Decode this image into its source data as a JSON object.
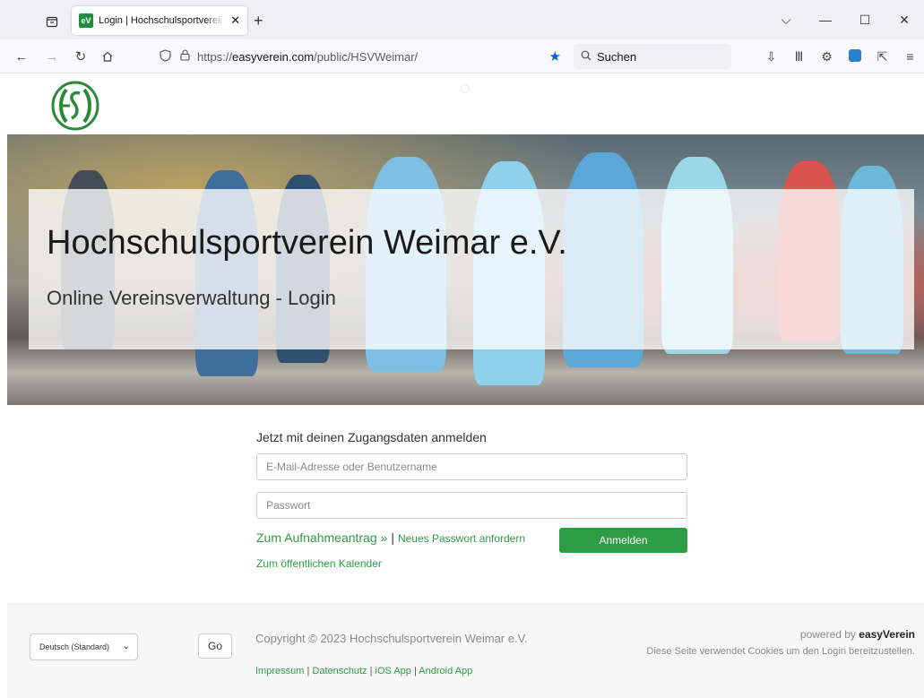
{
  "browser": {
    "tab_title": "Login | Hochschulsportverein Weimar e.V.",
    "tab_favicon": "eV",
    "url_prefix": "https://",
    "url_domain": "easyverein.com",
    "url_path": "/public/HSVWeimar/",
    "search_placeholder": "Suchen",
    "accent": "#0061e0"
  },
  "page": {
    "logo_alt": "HSV",
    "hero": {
      "title": "Hochschulsportverein Weimar e.V.",
      "subtitle": "Online Vereinsverwaltung - Login"
    },
    "login": {
      "heading": "Jetzt mit deinen Zugangsdaten anmelden",
      "username_placeholder": "E-Mail-Adresse oder Benutzername",
      "password_placeholder": "Passwort",
      "membership_link": "Zum Aufnahmeantrag »",
      "separator": "|",
      "reset_link": "Neues Passwort anfordern",
      "calendar_link": "Zum öffentlichen Kalender",
      "submit_label": "Anmelden"
    },
    "footer": {
      "language_selected": "Deutsch (Standard)",
      "go_label": "Go",
      "copyright": "Copyright © 2023 Hochschulsportverein Weimar e.V.",
      "links": [
        "Impressum",
        "Datenschutz",
        "iOS App",
        "Android App"
      ],
      "powered_prefix": "powered by ",
      "powered_brand_light": "easy",
      "powered_brand_bold": "Verein",
      "cookie_notice": "Diese Seite verwendet Cookies um den Login bereitzustellen."
    },
    "brand_green": "#2e9b45"
  }
}
